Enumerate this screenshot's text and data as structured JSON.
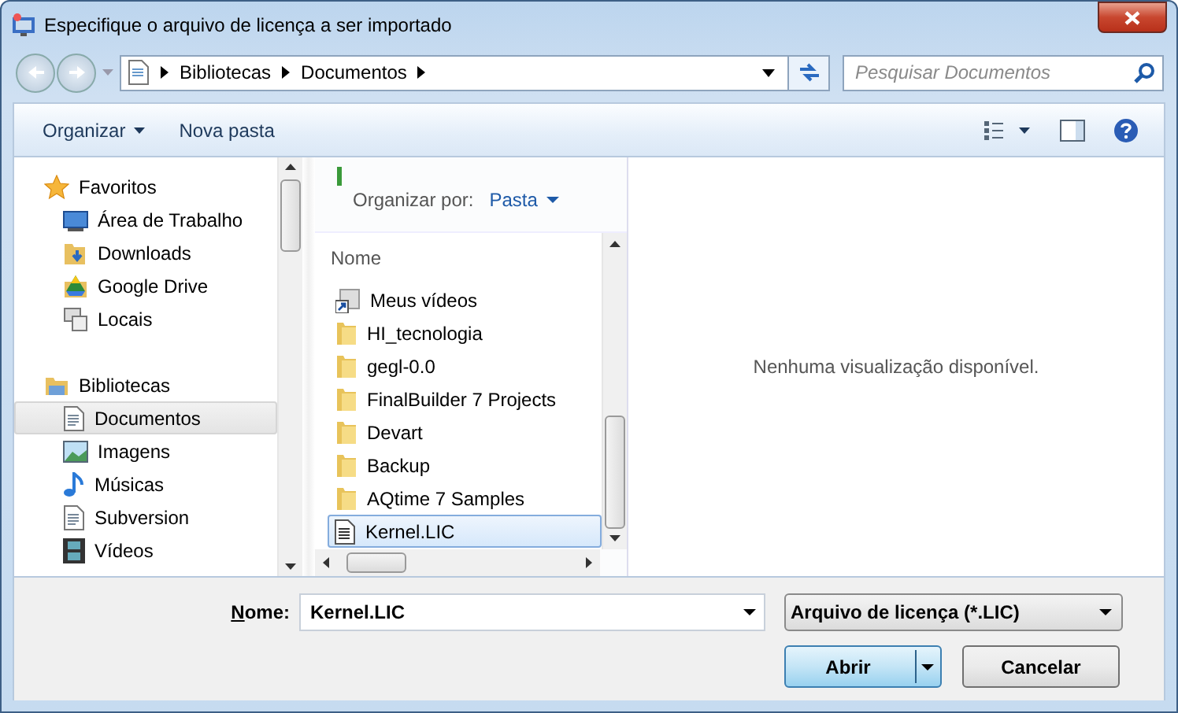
{
  "window": {
    "title": "Especifique o arquivo de licença a ser importado"
  },
  "address": {
    "crumbs": [
      "Bibliotecas",
      "Documentos"
    ]
  },
  "search": {
    "placeholder": "Pesquisar Documentos"
  },
  "toolbar": {
    "organize": "Organizar",
    "new_folder": "Nova pasta"
  },
  "sidebar": [
    {
      "label": "Favoritos",
      "kind": "star",
      "items": [
        {
          "label": "Área de Trabalho",
          "kind": "desktop",
          "selected": false
        },
        {
          "label": "Downloads",
          "kind": "download",
          "selected": false
        },
        {
          "label": "Google Drive",
          "kind": "drive",
          "selected": false
        },
        {
          "label": "Locais",
          "kind": "places",
          "selected": false
        }
      ]
    },
    {
      "label": "Bibliotecas",
      "kind": "library",
      "items": [
        {
          "label": "Documentos",
          "kind": "doc",
          "selected": true
        },
        {
          "label": "Imagens",
          "kind": "image",
          "selected": false
        },
        {
          "label": "Músicas",
          "kind": "music",
          "selected": false
        },
        {
          "label": "Subversion",
          "kind": "doc2",
          "selected": false
        },
        {
          "label": "Vídeos",
          "kind": "video",
          "selected": false
        }
      ]
    }
  ],
  "file_list": {
    "arrange_label": "Organizar por:",
    "arrange_value": "Pasta",
    "column": "Nome",
    "rows": [
      {
        "name": "Meus vídeos",
        "kind": "shortcut",
        "selected": false
      },
      {
        "name": "HI_tecnologia",
        "kind": "folder",
        "selected": false
      },
      {
        "name": "gegl-0.0",
        "kind": "folder",
        "selected": false
      },
      {
        "name": "FinalBuilder 7 Projects",
        "kind": "folder",
        "selected": false
      },
      {
        "name": "Devart",
        "kind": "folder",
        "selected": false
      },
      {
        "name": "Backup",
        "kind": "folder",
        "selected": false
      },
      {
        "name": "AQtime 7 Samples",
        "kind": "folder",
        "selected": false
      },
      {
        "name": "Kernel.LIC",
        "kind": "file",
        "selected": true
      }
    ]
  },
  "preview": {
    "message": "Nenhuma visualização disponível."
  },
  "footer": {
    "filename_label": "Nome:",
    "filename": "Kernel.LIC",
    "filter": "Arquivo de licença (*.LIC)",
    "buttons": [
      {
        "label": "Abrir",
        "kind": "split"
      },
      {
        "label": "Cancelar",
        "kind": "plain"
      }
    ]
  }
}
